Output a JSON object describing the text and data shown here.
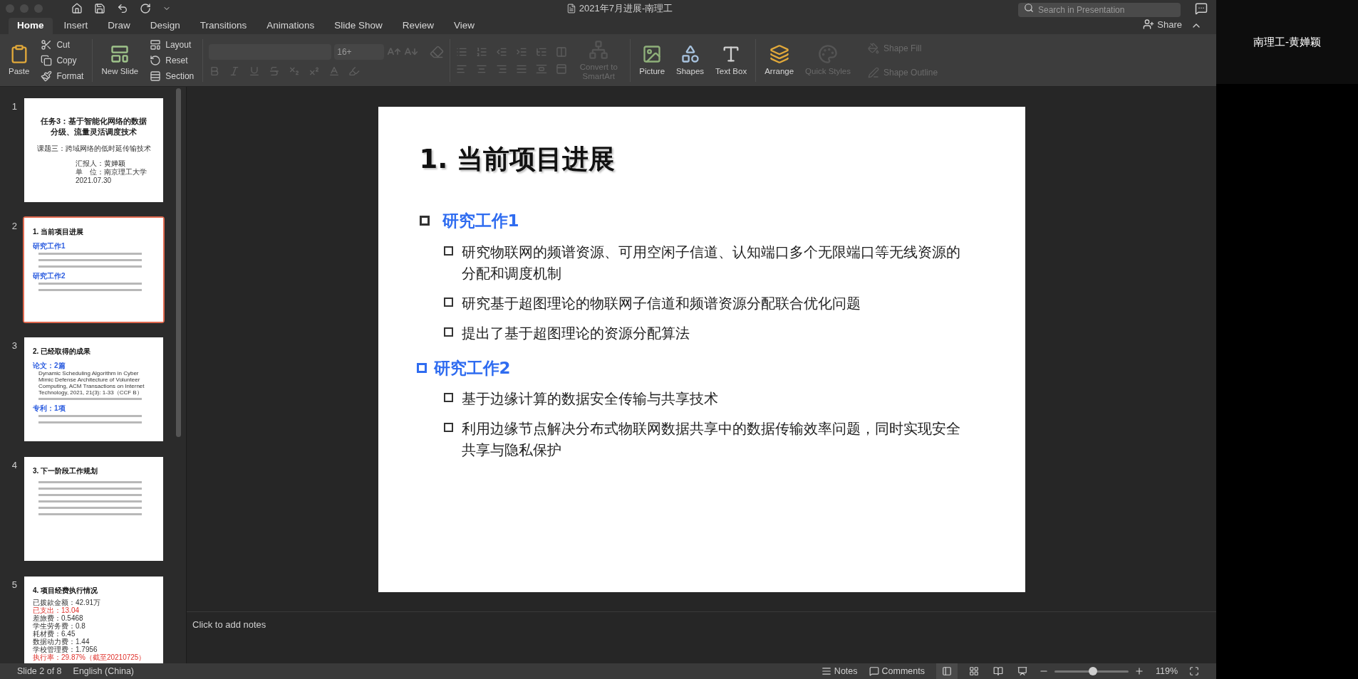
{
  "window": {
    "title": "2021年7月进展-南理工"
  },
  "search": {
    "placeholder": "Search in Presentation"
  },
  "share": "Share",
  "ribbon_tabs": [
    {
      "label": "Home",
      "selected": true
    },
    {
      "label": "Insert",
      "selected": false
    },
    {
      "label": "Draw",
      "selected": false
    },
    {
      "label": "Design",
      "selected": false
    },
    {
      "label": "Transitions",
      "selected": false
    },
    {
      "label": "Animations",
      "selected": false
    },
    {
      "label": "Slide Show",
      "selected": false
    },
    {
      "label": "Review",
      "selected": false
    },
    {
      "label": "View",
      "selected": false
    }
  ],
  "ribbon": {
    "paste": {
      "label": "Paste",
      "disabled": false
    },
    "clipboard": [
      {
        "label": "Cut",
        "disabled": false
      },
      {
        "label": "Copy",
        "disabled": false
      },
      {
        "label": "Format",
        "disabled": false
      }
    ],
    "new_slide": {
      "label": "New Slide",
      "disabled": false
    },
    "slides": [
      {
        "label": "Layout",
        "disabled": false
      },
      {
        "label": "Reset",
        "disabled": false
      },
      {
        "label": "Section",
        "disabled": false
      }
    ],
    "font": {
      "size": "16+",
      "disabled": true
    },
    "convert": {
      "label": "Convert to SmartArt",
      "disabled": true
    },
    "insert": [
      {
        "label": "Picture",
        "disabled": false
      },
      {
        "label": "Shapes",
        "disabled": false
      },
      {
        "label": "Text Box",
        "disabled": false
      },
      {
        "label": "Arrange",
        "disabled": false
      },
      {
        "label": "Quick Styles",
        "disabled": true
      }
    ],
    "shape_format": [
      {
        "label": "Shape Fill",
        "disabled": true
      },
      {
        "label": "Shape Outline",
        "disabled": true
      }
    ]
  },
  "thumbnails": [
    {
      "number": "1",
      "selected": false,
      "lines": [
        {
          "kind": "title",
          "text": "任务3：基于智能化网络的数据"
        },
        {
          "kind": "title",
          "text": "分级、流量灵活调度技术"
        },
        {
          "kind": "subtitle",
          "text": "课题三：跨域网络的低时延传输技术"
        },
        {
          "kind": "info",
          "text": "汇报人：黄婵颖"
        },
        {
          "kind": "info",
          "text": "单　位：南京理工大学"
        },
        {
          "kind": "info",
          "text": "2021.07.30"
        }
      ]
    },
    {
      "number": "2",
      "selected": true,
      "lines": [
        {
          "kind": "heading",
          "text": "1. 当前项目进展"
        },
        {
          "kind": "section",
          "text": "研究工作1"
        },
        {
          "kind": "bar"
        },
        {
          "kind": "bar"
        },
        {
          "kind": "bar"
        },
        {
          "kind": "section",
          "text": "研究工作2"
        },
        {
          "kind": "bar"
        },
        {
          "kind": "bar"
        }
      ]
    },
    {
      "number": "3",
      "selected": false,
      "lines": [
        {
          "kind": "heading",
          "text": "2. 已经取得的成果"
        },
        {
          "kind": "section",
          "text": "论文：2篇"
        },
        {
          "kind": "english",
          "text": "Dynamic Scheduling Algorithm in Cyber Mimic Defense Architecture of Volunteer Computing, ACM Transactions on Internet Technology, 2021, 21(3): 1-33（CCF B）"
        },
        {
          "kind": "bar"
        },
        {
          "kind": "section",
          "text": "专利：1项"
        },
        {
          "kind": "bar"
        },
        {
          "kind": "bar"
        }
      ]
    },
    {
      "number": "4",
      "selected": false,
      "lines": [
        {
          "kind": "heading",
          "text": "3. 下一阶段工作规划"
        },
        {
          "kind": "bar"
        },
        {
          "kind": "bar"
        },
        {
          "kind": "bar"
        },
        {
          "kind": "bar"
        },
        {
          "kind": "bar"
        },
        {
          "kind": "bar"
        }
      ]
    },
    {
      "number": "5",
      "selected": false,
      "lines": [
        {
          "kind": "heading",
          "text": "4. 项目经费执行情况"
        },
        {
          "kind": "item",
          "text": "已拨款金额：42.91万"
        },
        {
          "kind": "alert",
          "text": "已支出：13.04"
        },
        {
          "kind": "item",
          "text": "差旅费：0.5468"
        },
        {
          "kind": "item",
          "text": "学生劳务费：0.8"
        },
        {
          "kind": "item",
          "text": "耗材费：6.45"
        },
        {
          "kind": "item",
          "text": "数据动力费：1.44"
        },
        {
          "kind": "item",
          "text": "学校管理费：1.7956"
        },
        {
          "kind": "alert",
          "text": "执行率：29.87%（截至20210725）"
        }
      ]
    }
  ],
  "slide": {
    "title": "1. 当前项目进展",
    "sections": [
      {
        "heading": "研究工作1",
        "items": [
          "研究物联网的频谱资源、可用空闲子信道、认知端口多个无限端口等无线资源的分配和调度机制",
          "研究基于超图理论的物联网子信道和频谱资源分配联合优化问题",
          "提出了基于超图理论的资源分配算法"
        ]
      },
      {
        "heading": "研究工作2",
        "items": [
          "基于边缘计算的数据安全传输与共享技术",
          "利用边缘节点解决分布式物联网数据共享中的数据传输效率问题，同时实现安全共享与隐私保护"
        ]
      }
    ]
  },
  "notes": {
    "placeholder": "Click to add notes"
  },
  "participant": "南理工-黄婵颖",
  "status_bar": {
    "slide": "Slide 2 of 8",
    "language": "English (China)",
    "notes": "Notes",
    "comments": "Comments",
    "zoom": {
      "level": 0.52,
      "reading": "119%"
    }
  }
}
